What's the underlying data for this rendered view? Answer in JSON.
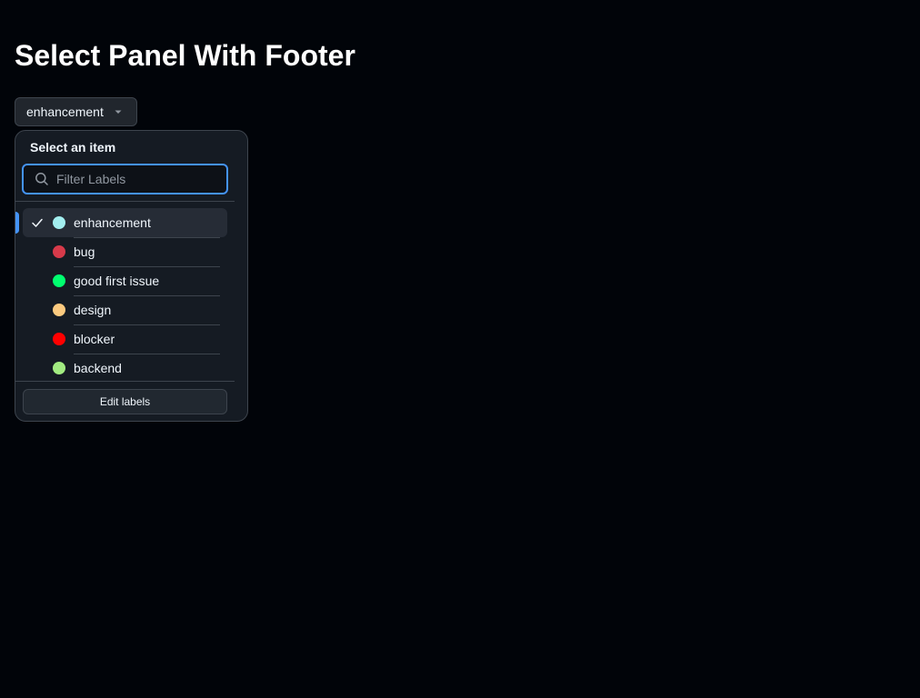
{
  "page": {
    "title": "Select Panel With Footer"
  },
  "trigger": {
    "label": "enhancement",
    "icon": "triangle-down-icon"
  },
  "panel": {
    "header": "Select an item",
    "filter": {
      "value": "",
      "placeholder": "Filter Labels",
      "icon": "search-icon"
    },
    "items": [
      {
        "label": "enhancement",
        "color": "#a2eeef",
        "selected": true
      },
      {
        "label": "bug",
        "color": "#d73a4a",
        "selected": false
      },
      {
        "label": "good first issue",
        "color": "#00ff6f",
        "selected": false
      },
      {
        "label": "design",
        "color": "#fbca7f",
        "selected": false
      },
      {
        "label": "blocker",
        "color": "#ff0000",
        "selected": false
      },
      {
        "label": "backend",
        "color": "#a2eb81",
        "selected": false
      }
    ],
    "footer": {
      "button_label": "Edit labels"
    }
  },
  "colors": {
    "background": "#010409",
    "panel": "#151b23",
    "accent": "#4493f8",
    "border": "#3d444d"
  }
}
